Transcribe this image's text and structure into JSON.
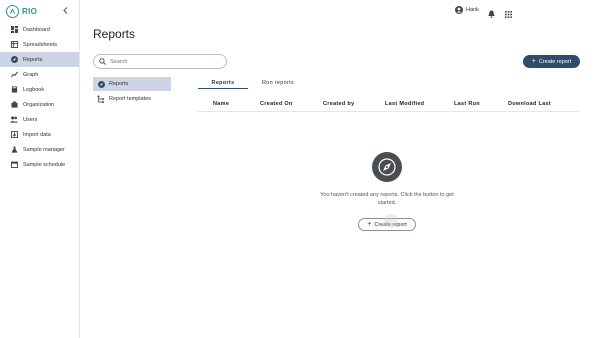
{
  "app": {
    "logo_text": "RIO"
  },
  "sidebar": {
    "items": [
      {
        "label": "Dashboard",
        "icon": "dashboard-icon"
      },
      {
        "label": "Spreadsheets",
        "icon": "spreadsheet-icon"
      },
      {
        "label": "Reports",
        "icon": "compass-icon",
        "active": true
      },
      {
        "label": "Graph",
        "icon": "graph-icon"
      },
      {
        "label": "Logbook",
        "icon": "book-icon"
      },
      {
        "label": "Organization",
        "icon": "organization-icon"
      },
      {
        "label": "Users",
        "icon": "users-icon"
      },
      {
        "label": "Import data",
        "icon": "import-icon"
      },
      {
        "label": "Sample manager",
        "icon": "flask-icon"
      },
      {
        "label": "Sample schedule",
        "icon": "calendar-icon"
      }
    ]
  },
  "topbar": {
    "user_name": "Hank"
  },
  "page": {
    "title": "Reports",
    "search_placeholder": "Search",
    "create_report_label": "Create report"
  },
  "subnav": {
    "items": [
      {
        "label": "Reports",
        "active": true
      },
      {
        "label": "Report templates"
      }
    ]
  },
  "tabs": [
    {
      "label": "Reports",
      "active": true
    },
    {
      "label": "Run reports"
    }
  ],
  "table": {
    "columns": [
      "Name",
      "Created On",
      "Created by",
      "Last Modified",
      "Last Run",
      "Download Last"
    ]
  },
  "empty_state": {
    "message": "You haven't created any reports. Click the button to get started.",
    "button_label": "Create report"
  },
  "colors": {
    "accent": "#2f4d6b",
    "active_bg": "#cdd4e3",
    "brand": "#2f8f95"
  }
}
